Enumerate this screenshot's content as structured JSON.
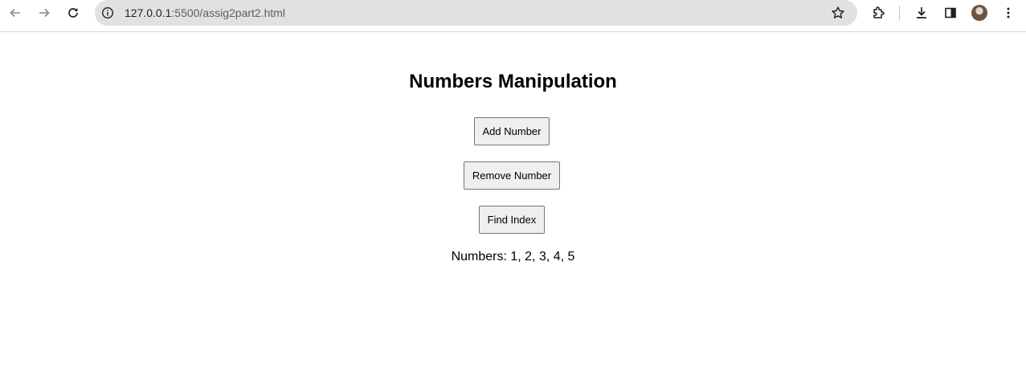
{
  "browser": {
    "url_host": "127.0.0.1",
    "url_path": ":5500/assig2part2.html",
    "icons": [
      "back-icon",
      "forward-icon",
      "reload-icon",
      "site-info-icon",
      "bookmark-star-icon",
      "extensions-icon",
      "download-icon",
      "side-panel-icon",
      "profile-avatar",
      "menu-icon"
    ]
  },
  "page": {
    "title": "Numbers Manipulation",
    "buttons": {
      "add": "Add Number",
      "remove": "Remove Number",
      "find": "Find Index"
    },
    "numbers_text": "Numbers: 1, 2, 3, 4, 5"
  }
}
